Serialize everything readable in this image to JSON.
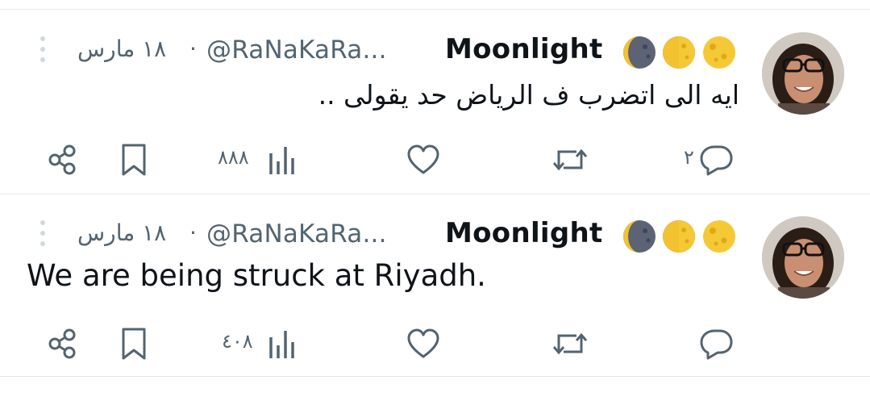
{
  "tweets": [
    {
      "author": {
        "name": "Moonlight",
        "emoji": [
          "waning-crescent-moon-icon",
          "first-quarter-moon-icon",
          "full-moon-icon"
        ],
        "handle": "@RaNaKaRa...",
        "separator": "·",
        "date": "١٨ مارس"
      },
      "text": "ايه الى اتضرب ف الرياض حد يقولى ..",
      "text_dir": "rtl",
      "actions": {
        "replies": "٢",
        "reposts": "",
        "likes": "",
        "views": "٨٨٨"
      }
    },
    {
      "author": {
        "name": "Moonlight",
        "emoji": [
          "waning-crescent-moon-icon",
          "first-quarter-moon-icon",
          "full-moon-icon"
        ],
        "handle": "@RaNaKaRa...",
        "separator": "·",
        "date": "١٨ مارس"
      },
      "text": "We are being struck at Riyadh.",
      "text_dir": "ltr",
      "actions": {
        "replies": "",
        "reposts": "",
        "likes": "",
        "views": "٤٠٨"
      }
    }
  ],
  "colors": {
    "text": "#0f1419",
    "secondary": "#536471",
    "divider": "#e4e7ea"
  }
}
